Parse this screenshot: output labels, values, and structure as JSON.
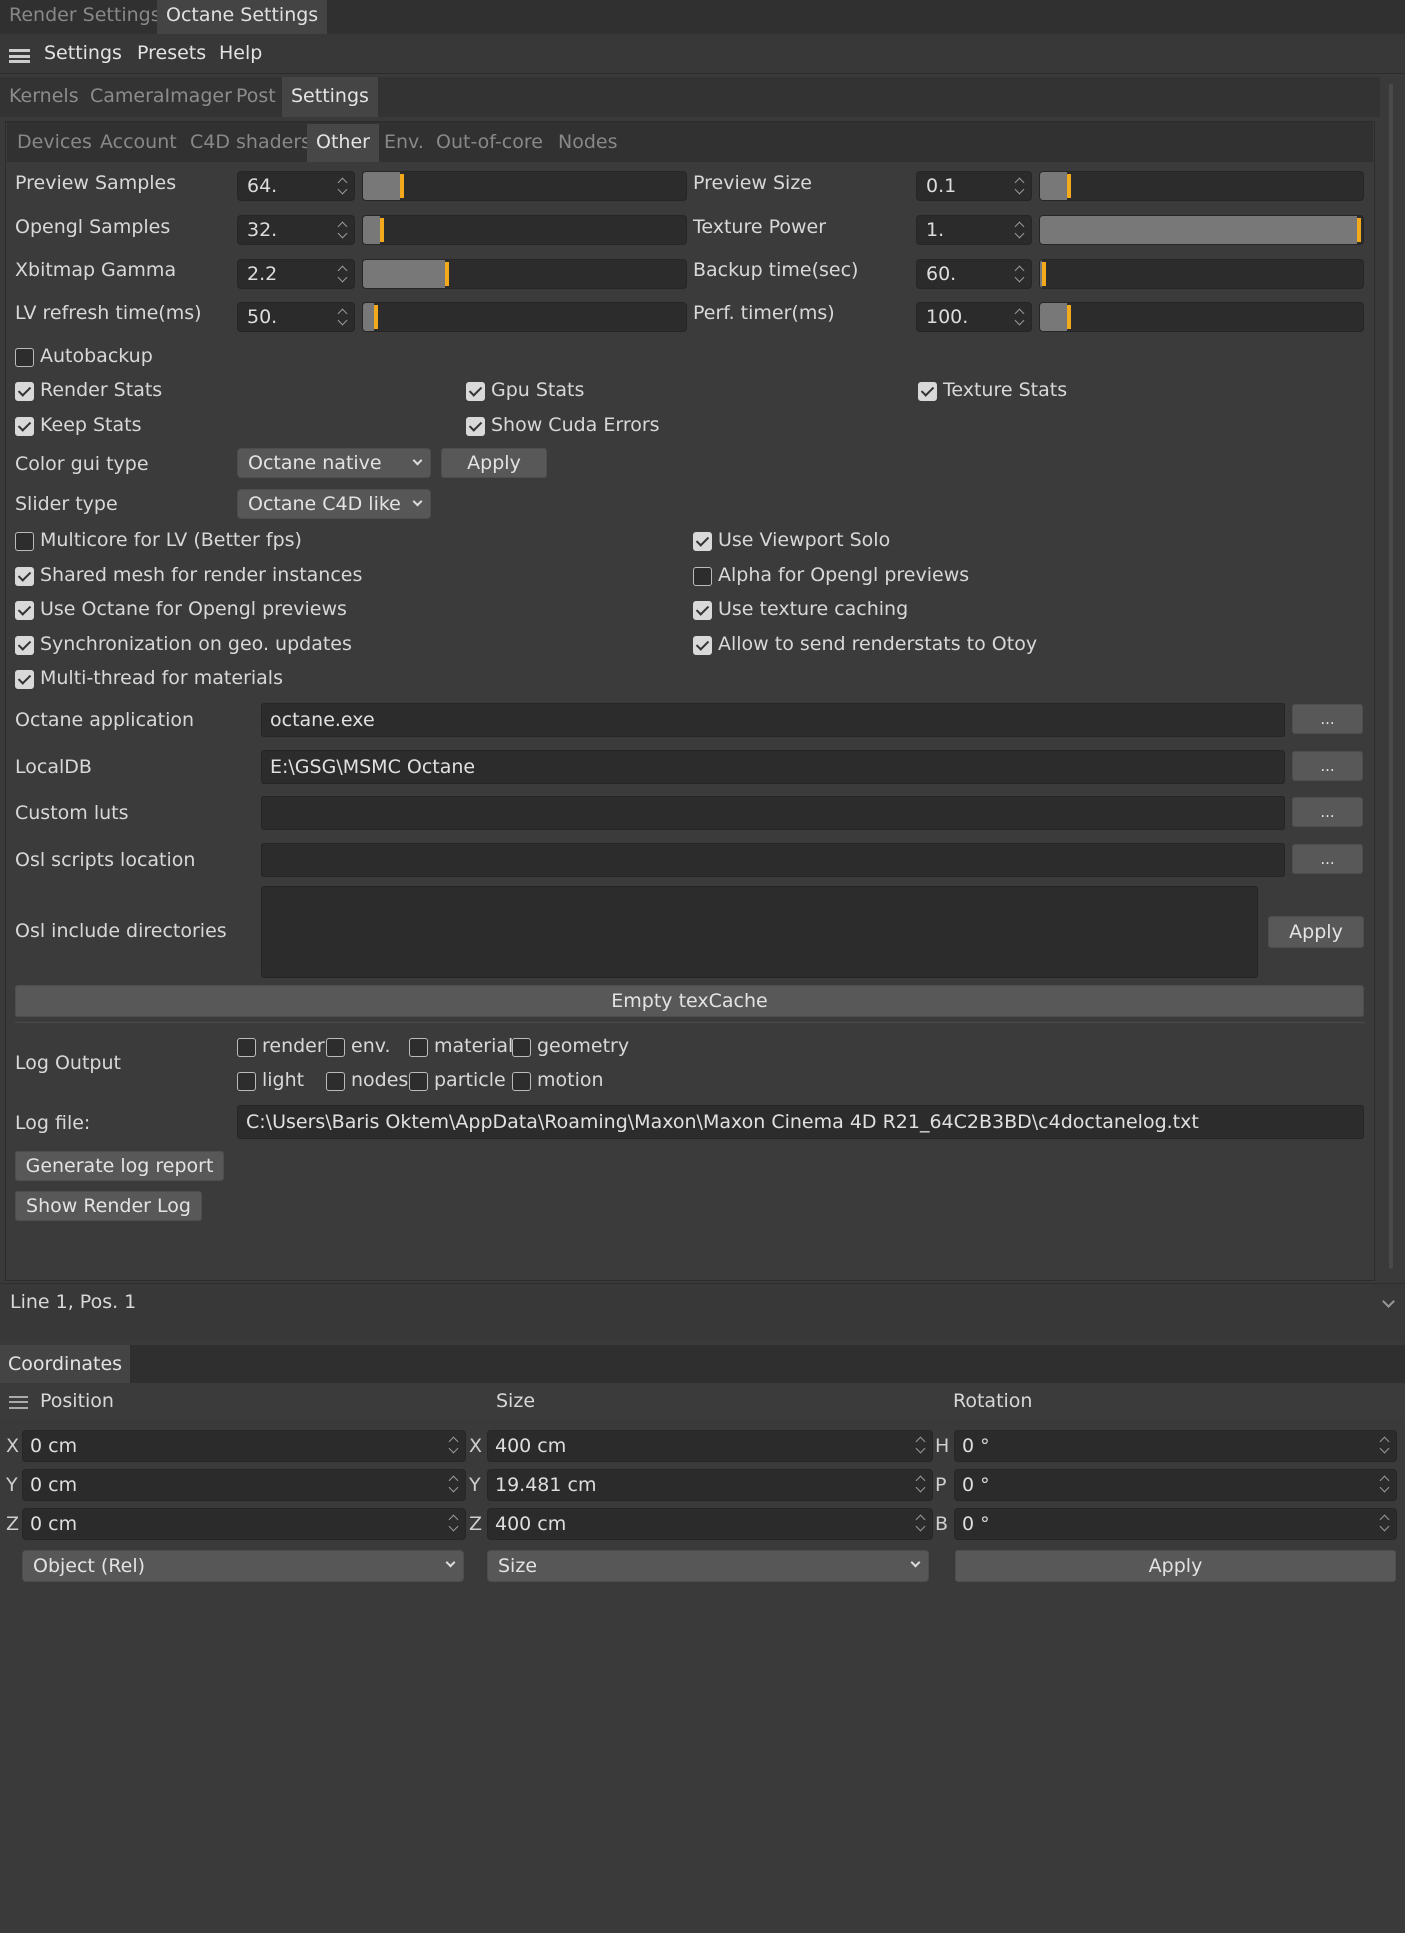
{
  "top_tabs": [
    "Render Settings",
    "Octane Settings"
  ],
  "menu": [
    "Settings",
    "Presets",
    "Help"
  ],
  "main_tabs": [
    "Kernels",
    "CameraImager",
    "Post",
    "Settings"
  ],
  "sub_tabs": [
    "Devices",
    "Account",
    "C4D shaders",
    "Other",
    "Env.",
    "Out-of-core",
    "Nodes"
  ],
  "params": [
    {
      "label": "Preview Samples",
      "value": "64.",
      "level": 0.12
    },
    {
      "label": "Opengl Samples",
      "value": "32.",
      "level": 0.06
    },
    {
      "label": "Xbitmap Gamma",
      "value": "2.2",
      "level": 0.26
    },
    {
      "label": "LV refresh time(ms)",
      "value": "50.",
      "level": 0.04
    },
    {
      "label": "Preview Size",
      "value": "0.1",
      "level": 0.09
    },
    {
      "label": "Texture Power",
      "value": "1.",
      "level": 1.0
    },
    {
      "label": "Backup time(sec)",
      "value": "60.",
      "level": 0.0
    },
    {
      "label": "Perf. timer(ms)",
      "value": "100.",
      "level": 0.09
    }
  ],
  "checkboxes": {
    "autobackup": {
      "label": "Autobackup",
      "checked": false
    },
    "render_stats": {
      "label": "Render Stats",
      "checked": true
    },
    "gpu_stats": {
      "label": "Gpu Stats",
      "checked": true
    },
    "texture_stats": {
      "label": "Texture Stats",
      "checked": true
    },
    "keep_stats": {
      "label": "Keep Stats",
      "checked": true
    },
    "show_cuda_errors": {
      "label": "Show Cuda Errors",
      "checked": true
    },
    "multicore_lv": {
      "label": "Multicore for LV (Better fps)",
      "checked": false
    },
    "shared_mesh": {
      "label": "Shared mesh for render instances",
      "checked": true
    },
    "use_octane_opengl": {
      "label": "Use Octane for Opengl previews",
      "checked": true
    },
    "sync_geo": {
      "label": "Synchronization on geo. updates",
      "checked": true
    },
    "multithread_materials": {
      "label": "Multi-thread for materials",
      "checked": true
    },
    "use_viewport_solo": {
      "label": "Use Viewport Solo",
      "checked": true
    },
    "alpha_opengl": {
      "label": "Alpha for Opengl previews",
      "checked": false
    },
    "texture_caching": {
      "label": "Use texture caching",
      "checked": true
    },
    "send_renderstats": {
      "label": "Allow to send renderstats to Otoy",
      "checked": true
    }
  },
  "color_gui_type": {
    "label": "Color gui type",
    "value": "Octane native",
    "apply": "Apply"
  },
  "slider_type": {
    "label": "Slider type",
    "value": "Octane C4D like"
  },
  "paths": {
    "octane_app": {
      "label": "Octane application",
      "value": "octane.exe",
      "browse": "..."
    },
    "localdb": {
      "label": "LocalDB",
      "value": "E:\\GSG\\MSMC Octane",
      "browse": "..."
    },
    "custom_luts": {
      "label": "Custom luts",
      "value": "",
      "browse": "..."
    },
    "osl_scripts": {
      "label": "Osl scripts location",
      "value": "",
      "browse": "..."
    }
  },
  "osl_include": {
    "label": "Osl include directories",
    "apply": "Apply"
  },
  "empty_texcache": "Empty texCache",
  "log_output": {
    "label": "Log Output",
    "options": [
      {
        "label": "render",
        "checked": false
      },
      {
        "label": "env.",
        "checked": false
      },
      {
        "label": "material",
        "checked": false
      },
      {
        "label": "geometry",
        "checked": false
      },
      {
        "label": "light",
        "checked": false
      },
      {
        "label": "nodes",
        "checked": false
      },
      {
        "label": "particle",
        "checked": false
      },
      {
        "label": "motion",
        "checked": false
      }
    ]
  },
  "log_file": {
    "label": "Log file:",
    "value": "C:\\Users\\Baris Oktem\\AppData\\Roaming\\Maxon\\Maxon Cinema 4D R21_64C2B3BD\\c4doctanelog.txt"
  },
  "buttons": {
    "generate_log": "Generate log report",
    "show_render_log": "Show Render Log"
  },
  "status": "Line 1, Pos. 1",
  "coordinates": {
    "tab": "Coordinates",
    "headers": [
      "Position",
      "Size",
      "Rotation"
    ],
    "position": [
      {
        "axis": "X",
        "value": "0 cm"
      },
      {
        "axis": "Y",
        "value": "0 cm"
      },
      {
        "axis": "Z",
        "value": "0 cm"
      }
    ],
    "size": [
      {
        "axis": "X",
        "value": "400 cm"
      },
      {
        "axis": "Y",
        "value": "19.481 cm"
      },
      {
        "axis": "Z",
        "value": "400 cm"
      }
    ],
    "rotation": [
      {
        "axis": "H",
        "value": "0 °"
      },
      {
        "axis": "P",
        "value": "0 °"
      },
      {
        "axis": "B",
        "value": "0 °"
      }
    ],
    "mode": "Object (Rel)",
    "size_mode": "Size",
    "apply": "Apply"
  },
  "colors": {
    "accent": "#f2a91c",
    "background": "#3a3a3a"
  }
}
